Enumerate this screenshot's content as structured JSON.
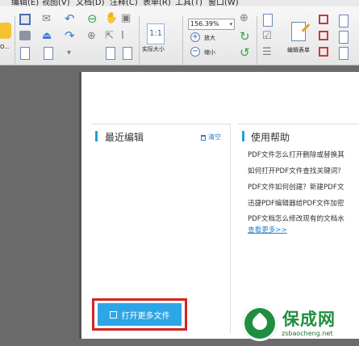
{
  "menu": {
    "items": [
      {
        "label": "编辑(E)"
      },
      {
        "label": "视图(V)"
      },
      {
        "label": "文档(D)"
      },
      {
        "label": "注释(C)"
      },
      {
        "label": "表单(R)"
      },
      {
        "label": "工具(T)"
      },
      {
        "label": "窗口(W)"
      }
    ]
  },
  "toolbar": {
    "actual_size_label": "实际大小",
    "actual_size_icon_text": "1:1",
    "zoom_value": "156.39%",
    "zoom_in_label": "放大",
    "zoom_out_label": "缩小",
    "edit_form_label": "编辑表单",
    "left_partial_label": "O..."
  },
  "recent": {
    "title": "最近编辑",
    "clear_label": "清空",
    "open_more_label": "打开更多文件"
  },
  "help": {
    "title": "使用帮助",
    "items": [
      "PDF文件怎么打开删除或替换其",
      "如何打开PDF文件查找关键词？",
      "PDF文件如何创建？新建PDF文",
      "迅捷PDF编辑器给PDF文件加密",
      "PDF文档怎么修改现有的文档水"
    ],
    "more_label": "查看更多>>"
  },
  "watermark": {
    "brand": "保成网",
    "url": "zsbaocheng.net"
  },
  "colors": {
    "accent": "#2ea6e6",
    "highlight_border": "#d32424",
    "link": "#2a80d0",
    "watermark_green": "#1f8f3f"
  }
}
